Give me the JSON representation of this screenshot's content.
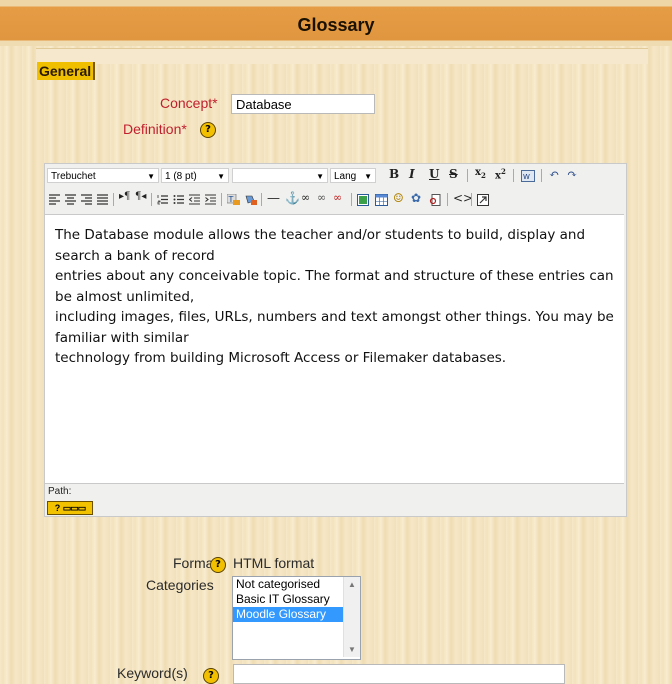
{
  "page": {
    "title": "Glossary"
  },
  "section": {
    "legend": "General"
  },
  "form": {
    "concept_label": "Concept*",
    "concept_value": "Database",
    "definition_label": "Definition*",
    "format_label": "Format",
    "format_value": "HTML format",
    "categories_label": "Categories",
    "categories": [
      "Not categorised",
      "Basic IT Glossary",
      "Moodle Glossary"
    ],
    "selected_category": "Moodle Glossary",
    "keywords_label": "Keyword(s)",
    "keywords_value": ""
  },
  "editor": {
    "font_family": "Trebuchet",
    "font_size": "1 (8 pt)",
    "format_block": "",
    "lang": "Lang",
    "content_lines": [
      "The Database module allows the teacher and/or students to build, display and search a bank of record",
      "entries about any conceivable topic. The format and structure of these entries can be almost unlimited,",
      "including images, files, URLs, numbers and text amongst other things. You may be familiar with similar",
      "technology from building Microsoft Access or Filemaker databases."
    ],
    "path_label": "Path:"
  },
  "help_glyph": "?",
  "colors": {
    "required": "#c0202e",
    "titlebar": "#e0963f",
    "legend": "#f0c000",
    "selection": "#3399ff"
  }
}
